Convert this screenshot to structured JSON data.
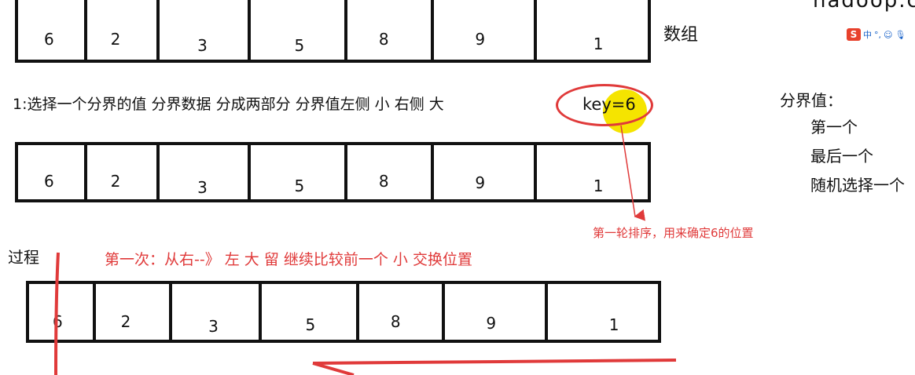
{
  "top_right_cropped_text": "hadoop.c",
  "ime_toolbar": {
    "logo": "S",
    "glyphs": [
      "中",
      "°,",
      "☺",
      "🎙"
    ]
  },
  "array_label": "数组",
  "arrays": [
    {
      "name": "array-top",
      "values": [
        "6",
        "2",
        "3",
        "5",
        "8",
        "9",
        "1"
      ]
    },
    {
      "name": "array-middle",
      "values": [
        "6",
        "2",
        "3",
        "5",
        "8",
        "9",
        "1"
      ]
    },
    {
      "name": "array-bottom",
      "values": [
        "6",
        "2",
        "3",
        "5",
        "8",
        "9",
        "1"
      ]
    }
  ],
  "step1_text": "1:选择一个分界的值  分界数据   分成两部分 分界值左侧 小  右侧  大",
  "key_label": "key=6",
  "pivot_panel": {
    "title": "分界值：",
    "options": [
      "第一个",
      "最后一个",
      "随机选择一个"
    ]
  },
  "annotation_red": "第一轮排序，用来确定6的位置",
  "process_label": "过程",
  "first_pass_text": "第一次：从右--》 左   大  留 继续比较前一个     小 交换位置",
  "colors": {
    "annotation": "#e03a3a",
    "highlight": "#f5e400",
    "line": "#111111"
  }
}
